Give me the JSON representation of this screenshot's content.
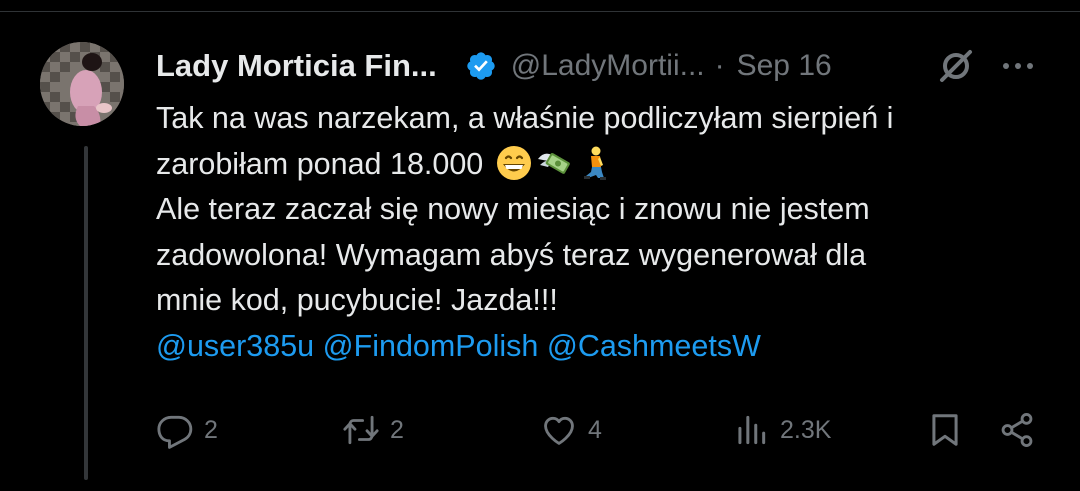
{
  "tweet": {
    "author_name": "Lady Morticia Fin...",
    "handle": "@LadyMortii...",
    "separator": "·",
    "date": "Sep 16",
    "text_lines": [
      "Tak na was narzekam, a właśnie podliczyłam sierpień i",
      "zarobiłam ponad 18.000",
      "Ale teraz zaczał się nowy miesiąc i znowu nie jestem",
      "zadowolona! Wymagam abyś teraz wygenerował dla",
      "mnie kod, pucybucie! Jazda!!!"
    ],
    "emojis": [
      "grinning-face-emoji",
      "money-with-wings-emoji",
      "kneeling-person-emoji"
    ],
    "mentions": [
      "@user385u",
      "@FindomPolish",
      "@CashmeetsW"
    ]
  },
  "actions": {
    "replies": "2",
    "reposts": "2",
    "likes": "4",
    "views": "2.3K"
  },
  "colors": {
    "background": "#000000",
    "text": "#e7e9ea",
    "secondary": "#71767b",
    "link": "#1d9bf0",
    "verified": "#1d9bf0",
    "thread_line": "#333639"
  }
}
